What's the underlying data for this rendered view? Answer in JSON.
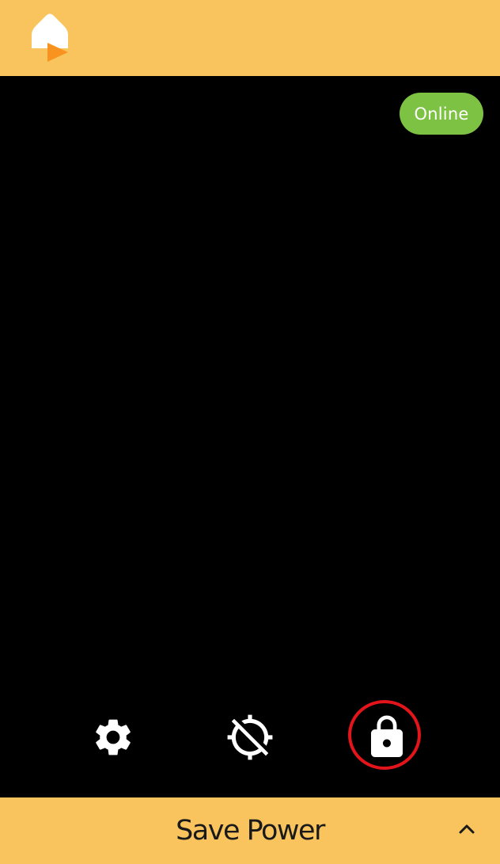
{
  "header": {
    "logo_icon": "home-play-logo-icon"
  },
  "main": {
    "status_badge": "Online",
    "status_color": "#7DC243"
  },
  "controls": [
    {
      "name": "settings",
      "icon": "gear-icon"
    },
    {
      "name": "location-off",
      "icon": "location-off-icon"
    },
    {
      "name": "lock",
      "icon": "lock-icon",
      "highlighted": true
    }
  ],
  "footer": {
    "label": "Save Power",
    "expand_icon": "chevron-up-icon"
  },
  "colors": {
    "bar": "#F9C45E",
    "highlight_ring": "#E4141B",
    "logo_accent": "#F7931E"
  }
}
